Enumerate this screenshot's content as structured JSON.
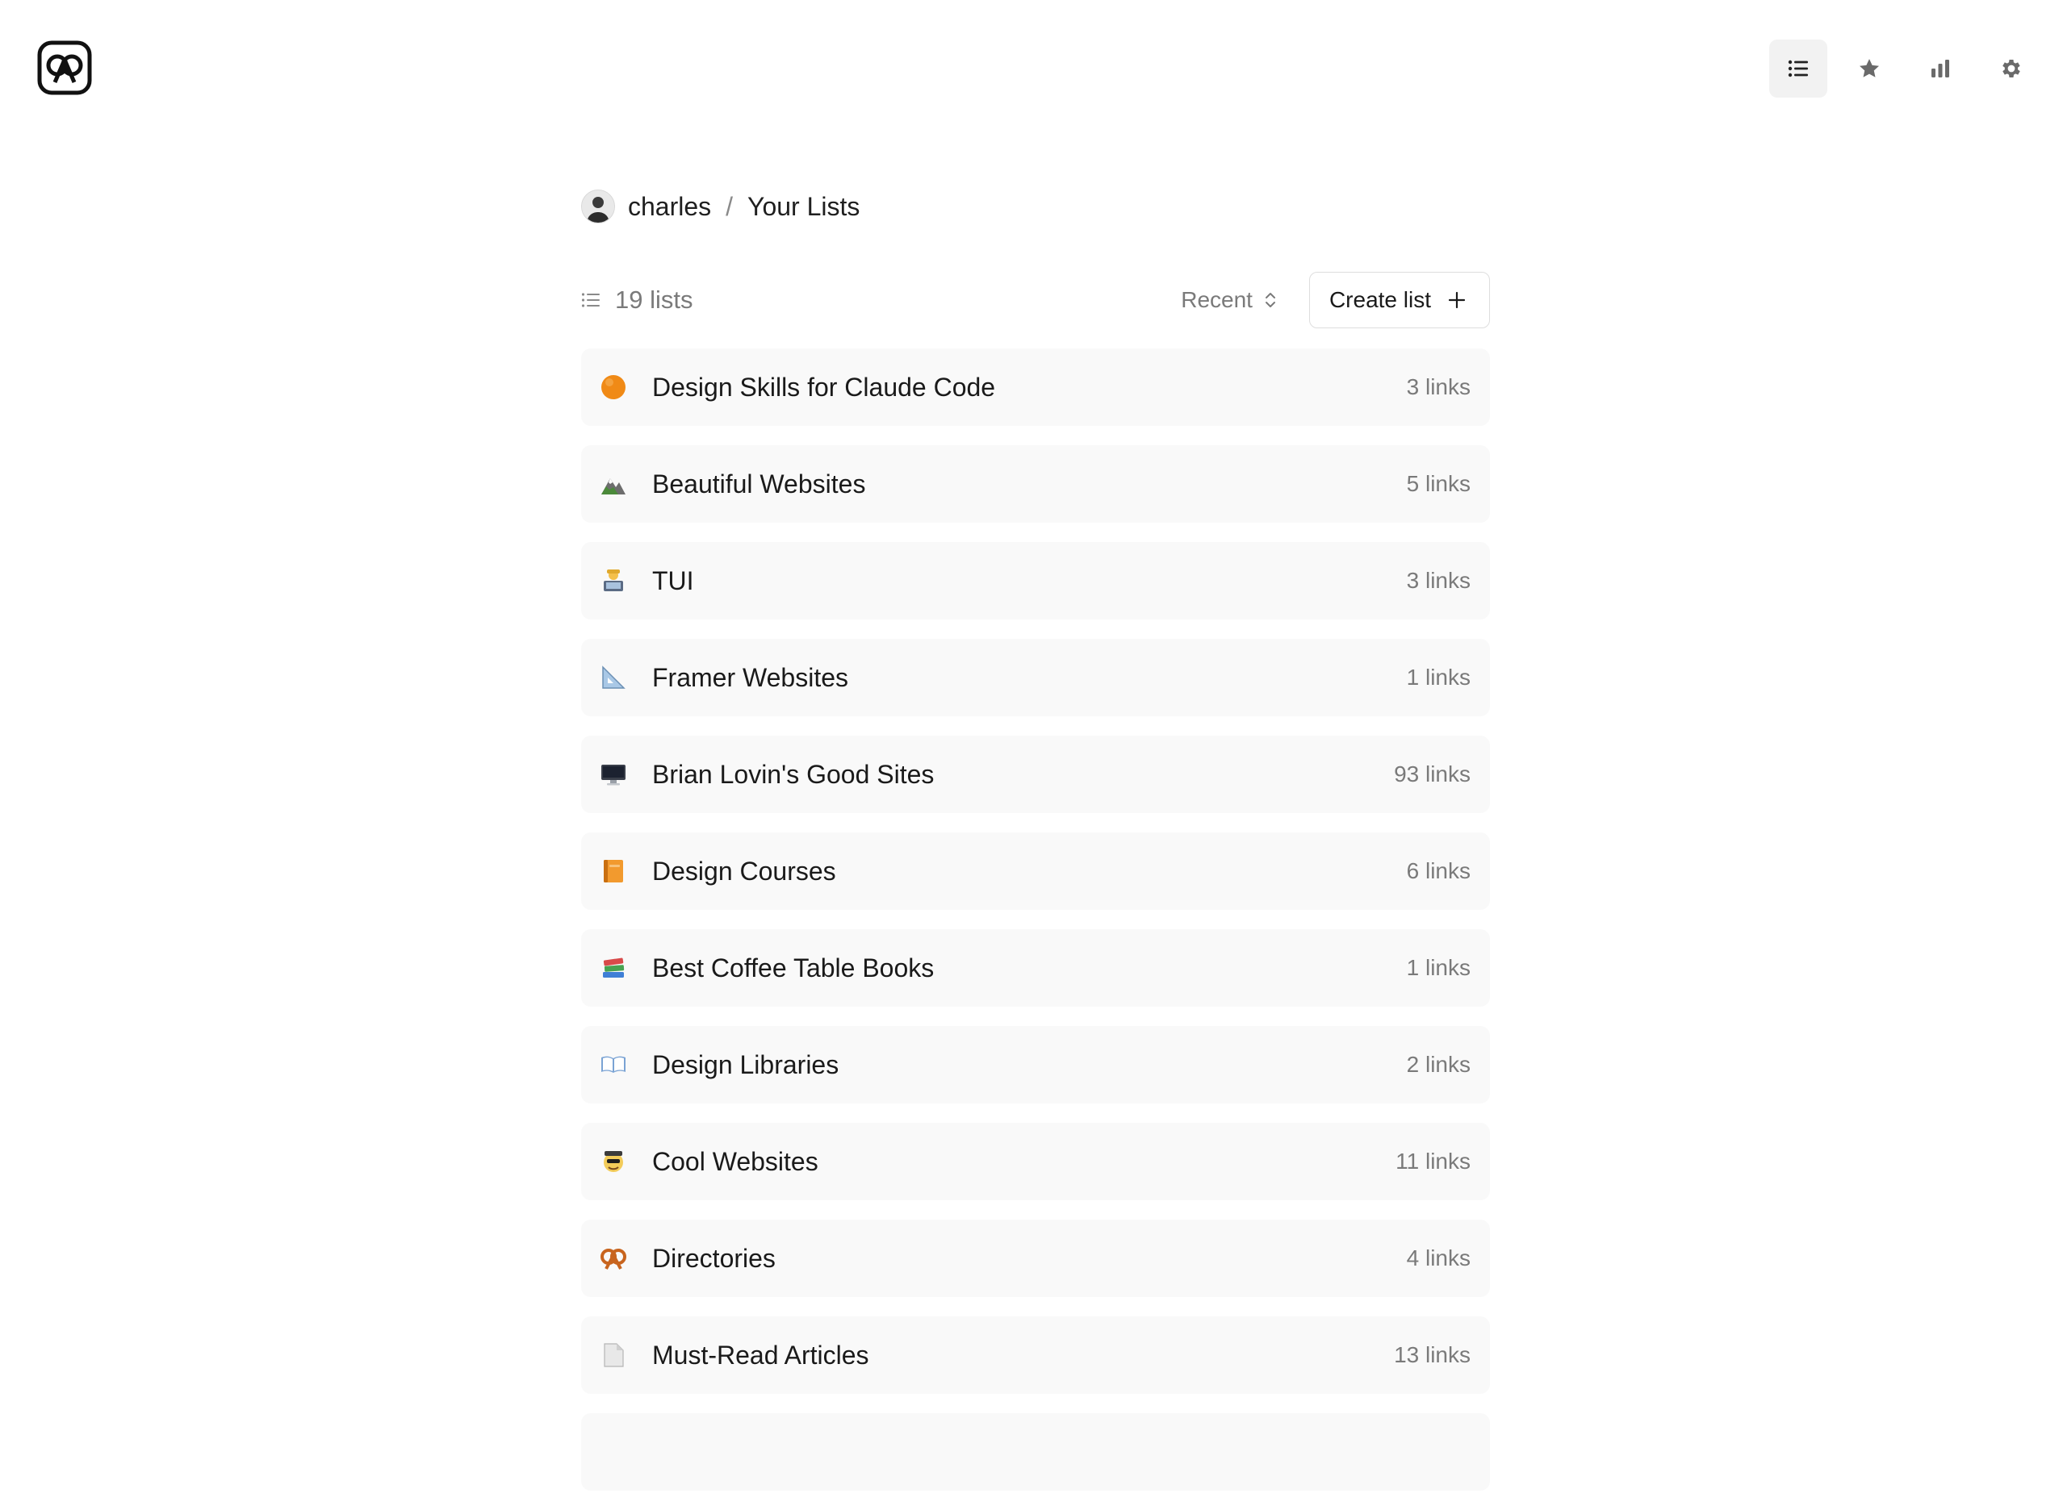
{
  "app": {
    "logo_icon": "pretzel-logo-icon"
  },
  "top_nav": [
    {
      "name": "lists",
      "icon": "list-icon",
      "active": true
    },
    {
      "name": "favorites",
      "icon": "star-icon",
      "active": false
    },
    {
      "name": "stats",
      "icon": "bar-chart-icon",
      "active": false
    },
    {
      "name": "settings",
      "icon": "gear-icon",
      "active": false
    }
  ],
  "breadcrumb": {
    "user": "charles",
    "separator": "/",
    "page": "Your Lists"
  },
  "toolbar": {
    "count_label": "19 lists",
    "sort_label": "Recent",
    "create_label": "Create list"
  },
  "lists": [
    {
      "emoji": "orange-circle-icon",
      "title": "Design Skills for Claude Code",
      "count": "3 links"
    },
    {
      "emoji": "mountain-icon",
      "title": "Beautiful Websites",
      "count": "5 links"
    },
    {
      "emoji": "technologist-icon",
      "title": "TUI",
      "count": "3 links"
    },
    {
      "emoji": "triangular-ruler-icon",
      "title": "Framer Websites",
      "count": "1 links"
    },
    {
      "emoji": "desktop-computer-icon",
      "title": "Brian Lovin's Good Sites",
      "count": "93 links"
    },
    {
      "emoji": "orange-book-icon",
      "title": "Design Courses",
      "count": "6 links"
    },
    {
      "emoji": "books-icon",
      "title": "Best Coffee Table Books",
      "count": "1 links"
    },
    {
      "emoji": "open-book-icon",
      "title": "Design Libraries",
      "count": "2 links"
    },
    {
      "emoji": "disguised-face-icon",
      "title": "Cool Websites",
      "count": "11 links"
    },
    {
      "emoji": "pretzel-icon",
      "title": "Directories",
      "count": "4 links"
    },
    {
      "emoji": "page-icon",
      "title": "Must-Read Articles",
      "count": "13 links"
    }
  ]
}
